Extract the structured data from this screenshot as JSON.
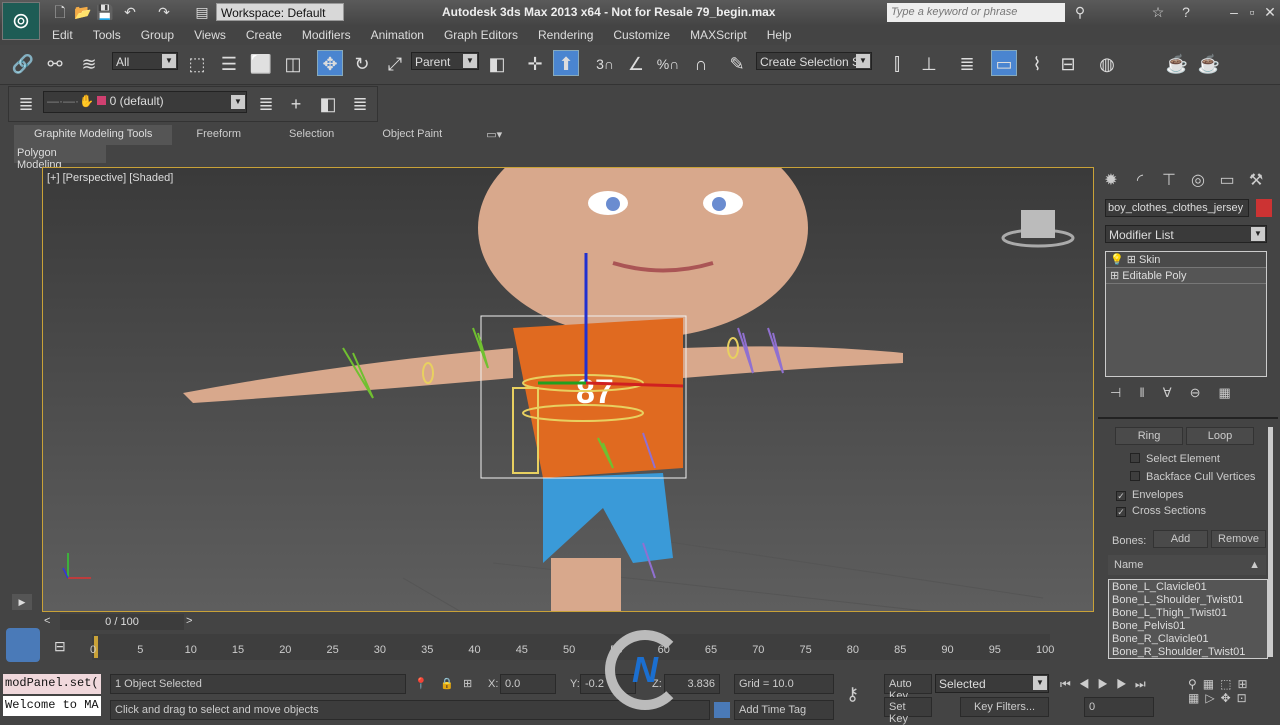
{
  "titlebar": {
    "workspace": "Workspace: Default",
    "title": "Autodesk 3ds Max  2013 x64   - Not for Resale    79_begin.max",
    "search_placeholder": "Type a keyword or phrase"
  },
  "menu": [
    "Edit",
    "Tools",
    "Group",
    "Views",
    "Create",
    "Modifiers",
    "Animation",
    "Graph Editors",
    "Rendering",
    "Customize",
    "MAXScript",
    "Help"
  ],
  "toolbar": {
    "selection_filter": "All",
    "ref_coord": "Parent",
    "named_selection": "Create Selection Se",
    "snap_label": "3"
  },
  "layers": {
    "current": "0 (default)",
    "layer_color": "#d04070"
  },
  "ribbon": {
    "tabs": [
      "Graphite Modeling Tools",
      "Freeform",
      "Selection",
      "Object Paint"
    ],
    "panel": "Polygon Modeling"
  },
  "viewport": {
    "label": "[+] [Perspective] [Shaded]",
    "jersey_number": "87",
    "border_color": "#c9a238"
  },
  "command_panel": {
    "object_name": "boy_clothes_clothes_jersey",
    "object_color": "#cc3333",
    "modifier_list": "Modifier List",
    "stack": [
      "Skin",
      "Editable Poly"
    ],
    "ring": "Ring",
    "loop": "Loop",
    "options": [
      {
        "label": "Select Element",
        "checked": false
      },
      {
        "label": "Backface Cull Vertices",
        "checked": false
      },
      {
        "label": "Envelopes",
        "checked": true
      },
      {
        "label": "Cross Sections",
        "checked": true
      }
    ],
    "bones_label": "Bones:",
    "add": "Add",
    "remove": "Remove",
    "name_header": "Name",
    "bones": [
      "Bone_L_Clavicle01",
      "Bone_L_Shoulder_Twist01",
      "Bone_L_Thigh_Twist01",
      "Bone_Pelvis01",
      "Bone_R_Clavicle01",
      "Bone_R_Shoulder_Twist01"
    ]
  },
  "timeline": {
    "frame": "0 / 100",
    "ticks": [
      "0",
      "5",
      "10",
      "15",
      "20",
      "25",
      "30",
      "35",
      "40",
      "45",
      "50",
      "55",
      "60",
      "65",
      "70",
      "75",
      "80",
      "85",
      "90",
      "95",
      "100"
    ]
  },
  "status": {
    "maxscript1": "modPanel.set(",
    "maxscript2": "Welcome to MA",
    "selected": "1 Object Selected",
    "prompt": "Click and drag to select and move objects",
    "x_label": "X:",
    "x": "0.0",
    "y_label": "Y:",
    "y": "-0.2",
    "z_label": "Z:",
    "z": "3.836",
    "grid": "Grid = 10.0",
    "add_time_tag": "Add Time Tag",
    "auto_key": "Auto Key",
    "key_mode": "Selected",
    "set_key": "Set Key",
    "key_filters": "Key Filters...",
    "current_frame": "0"
  }
}
